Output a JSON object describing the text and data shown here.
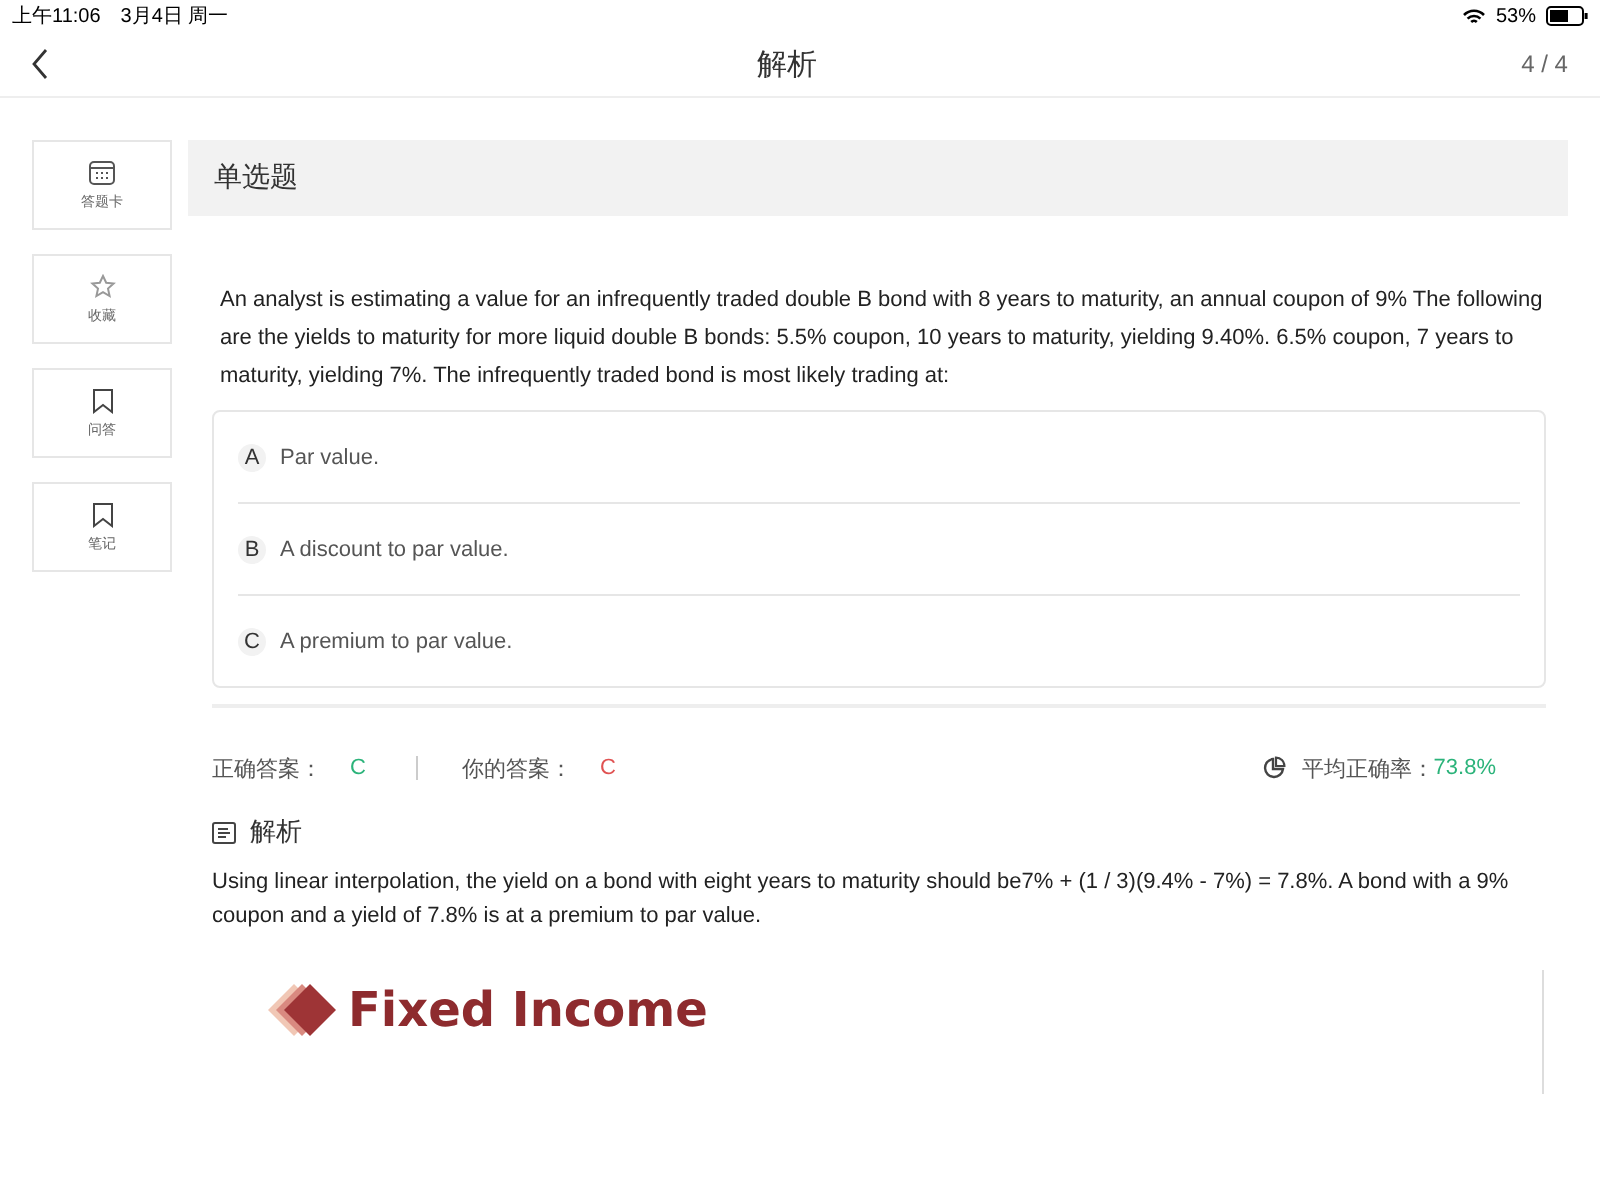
{
  "status_bar": {
    "time": "上午11:06",
    "date": "3月4日 周一",
    "battery": "53%"
  },
  "header": {
    "title": "解析",
    "progress": "4 / 4"
  },
  "sidebar": {
    "items": [
      {
        "label": "答题卡",
        "kind": "card"
      },
      {
        "label": "收藏",
        "kind": "star"
      },
      {
        "label": "问答",
        "kind": "bookmark"
      },
      {
        "label": "笔记",
        "kind": "bookmark"
      }
    ]
  },
  "question": {
    "type": "单选题",
    "text": "An analyst is estimating a value for an infrequently traded double B bond with 8 years to maturity, an annual coupon of 9% The following are the yields to maturity for more liquid double B bonds: 5.5% coupon, 10 years to maturity, yielding 9.40%. 6.5% coupon, 7 years to maturity, yielding 7%. The infrequently traded bond is most likely trading at:",
    "options": [
      {
        "letter": "A",
        "text": "Par value."
      },
      {
        "letter": "B",
        "text": "A discount to par value."
      },
      {
        "letter": "C",
        "text": "A premium to par value."
      }
    ]
  },
  "answers": {
    "correct_label": "正确答案：",
    "correct": "C",
    "yours_label": "你的答案：",
    "yours": "C",
    "average_label": "平均正确率：",
    "average": "73.8%"
  },
  "analysis": {
    "title": "解析",
    "text": "Using linear interpolation, the yield on a bond with eight years to maturity should be7% + (1 / 3)(9.4% - 7%) = 7.8%. A bond with a 9% coupon and a yield of 7.8% is at a premium to par value.",
    "logo_text": "Fixed Income"
  }
}
